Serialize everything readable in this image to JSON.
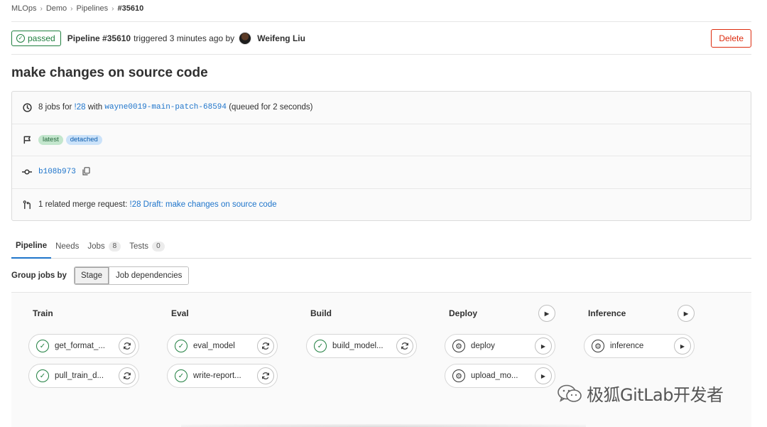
{
  "breadcrumb": [
    "MLOps",
    "Demo",
    "Pipelines",
    "#35610"
  ],
  "header": {
    "status": "passed",
    "pipeline": "Pipeline #35610",
    "triggered": "triggered 3 minutes ago by",
    "author": "Weifeng Liu",
    "delete_label": "Delete"
  },
  "title": "make changes on source code",
  "info": {
    "jobs_prefix": "8 jobs for",
    "mr_ref": "!28",
    "with": "with",
    "branch": "wayne0019-main-patch-68594",
    "queued": "(queued for 2 seconds)",
    "tags": [
      "latest",
      "detached"
    ],
    "commit": "b108b973",
    "related_prefix": "1 related merge request:",
    "related_link": "!28 Draft: make changes on source code"
  },
  "tabs": [
    {
      "label": "Pipeline",
      "count": null
    },
    {
      "label": "Needs",
      "count": null
    },
    {
      "label": "Jobs",
      "count": "8"
    },
    {
      "label": "Tests",
      "count": "0"
    }
  ],
  "group_by": {
    "label": "Group jobs by",
    "options": [
      "Stage",
      "Job dependencies"
    ],
    "selected": "Stage"
  },
  "stages": [
    {
      "name": "Train",
      "jobs": [
        "get_format_...",
        "pull_train_d..."
      ]
    },
    {
      "name": "Eval",
      "jobs": [
        "eval_model",
        "write-report..."
      ]
    },
    {
      "name": "Build",
      "jobs": [
        "build_model..."
      ]
    },
    {
      "name": "Deploy",
      "jobs": [
        "deploy",
        "upload_mo..."
      ]
    },
    {
      "name": "Inference",
      "jobs": [
        "inference"
      ]
    }
  ],
  "watermark": "极狐GitLab开发者",
  "colors": {
    "success": "#1f7f3f",
    "link": "#1f75cb",
    "danger": "#dd2b0e"
  },
  "icons": {
    "status_passed": "check-circle-icon",
    "retry": "retry-icon",
    "play": "play-icon",
    "manual": "gear-icon"
  }
}
